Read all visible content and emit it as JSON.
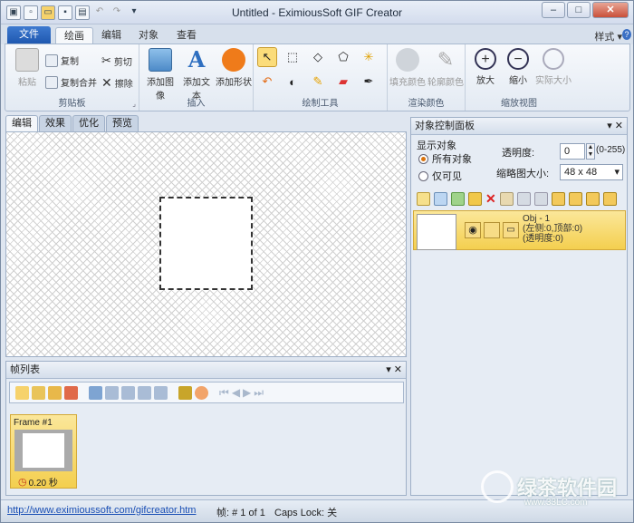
{
  "window": {
    "title": "Untitled - EximiousSoft GIF Creator",
    "minimize": "–",
    "maximize": "□",
    "close": "✕"
  },
  "ribbon_tabs": {
    "file": "文件",
    "draw": "绘画",
    "edit": "编辑",
    "object": "对象",
    "view": "查看",
    "style": "样式 ▾"
  },
  "clipboard": {
    "paste": "粘贴",
    "copy": "复制",
    "cut": "剪切",
    "copy_merge": "复制合并",
    "erase": "擦除",
    "label": "剪贴板"
  },
  "insert": {
    "add_image": "添加图像",
    "add_text": "添加文本",
    "add_shape": "添加形状",
    "label": "插入"
  },
  "draw_tools": {
    "label": "绘制工具"
  },
  "fill": {
    "fill_color": "填充颜色",
    "outline_color": "轮廓颜色",
    "label": "渲染颜色"
  },
  "zoom": {
    "zoom_in": "放大",
    "zoom_out": "缩小",
    "actual": "实际大小",
    "label": "缩放视图"
  },
  "doc_tabs": [
    "编辑",
    "效果",
    "优化",
    "预览"
  ],
  "object_panel": {
    "title": "对象控制面板",
    "show_label": "显示对象",
    "all_objects": "所有对象",
    "visible_only": "仅可见",
    "opacity_label": "透明度:",
    "opacity_value": "0",
    "opacity_range": "(0-255)",
    "thumb_label": "缩略图大小:",
    "thumb_value": "48 x 48",
    "obj_name": "Obj - 1",
    "obj_pos": "(左侧:0,顶部:0)",
    "obj_opacity": "(透明度:0)"
  },
  "frame_panel": {
    "title": "帧列表",
    "frame_name": "Frame #1",
    "delay": "0.20 秒"
  },
  "status": {
    "url": "http://www.eximioussoft.com/gifcreator.htm",
    "frame": "帧: # 1 of 1",
    "caps": "Caps Lock: 关"
  },
  "watermark": {
    "name": "绿茶软件园",
    "url": "www.33LC.com"
  },
  "colors": {
    "file_tab": "#2a63b8",
    "selected": "#f7d86a",
    "accent_orange": "#d9730d"
  }
}
